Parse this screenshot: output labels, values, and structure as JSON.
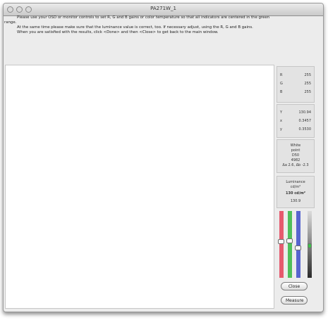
{
  "window": {
    "title": "PA271W_1"
  },
  "instructions": {
    "p1": "Please use your OSD or monitor controls to set R, G and B gains or color temperature so that all indicators are centered in the green range.",
    "p2": "At the same time please make sure that the luminance value is correct, too. If necessary adjust, using the R, G and B gains.",
    "p3": "When you are satisfied with the results, click <Done> and then <Close> to get back to the main window."
  },
  "rgb": {
    "r_label": "R",
    "r": "255",
    "g_label": "G",
    "g": "255",
    "b_label": "B",
    "b": "255"
  },
  "yxy": {
    "Y_label": "Y",
    "Y": "130.94",
    "x_label": "x",
    "x": "0.3457",
    "y_label": "y",
    "y": "0.3530"
  },
  "whitepoint": {
    "l1": "White",
    "l2": "point",
    "l3": "D50",
    "l4": "4982",
    "l5": "Δa 2.6, Δb -2.3"
  },
  "luminance": {
    "l1": "Luminance",
    "l2": "cd/m²",
    "target": "130 cd/m²",
    "value": "130.9"
  },
  "sliders": {
    "r_level": 0.55,
    "g_level": 0.56,
    "b_level": 0.45,
    "lum_level": 0.48,
    "colors": {
      "red": "#e65a6e",
      "green": "#4fbf5a",
      "blue": "#5865cf",
      "gray_top": "#dcdcdc",
      "gray_bottom": "#2a2a2a",
      "indicator": "#3fbf4a"
    }
  },
  "buttons": {
    "close": "Close",
    "measure": "Measure"
  }
}
